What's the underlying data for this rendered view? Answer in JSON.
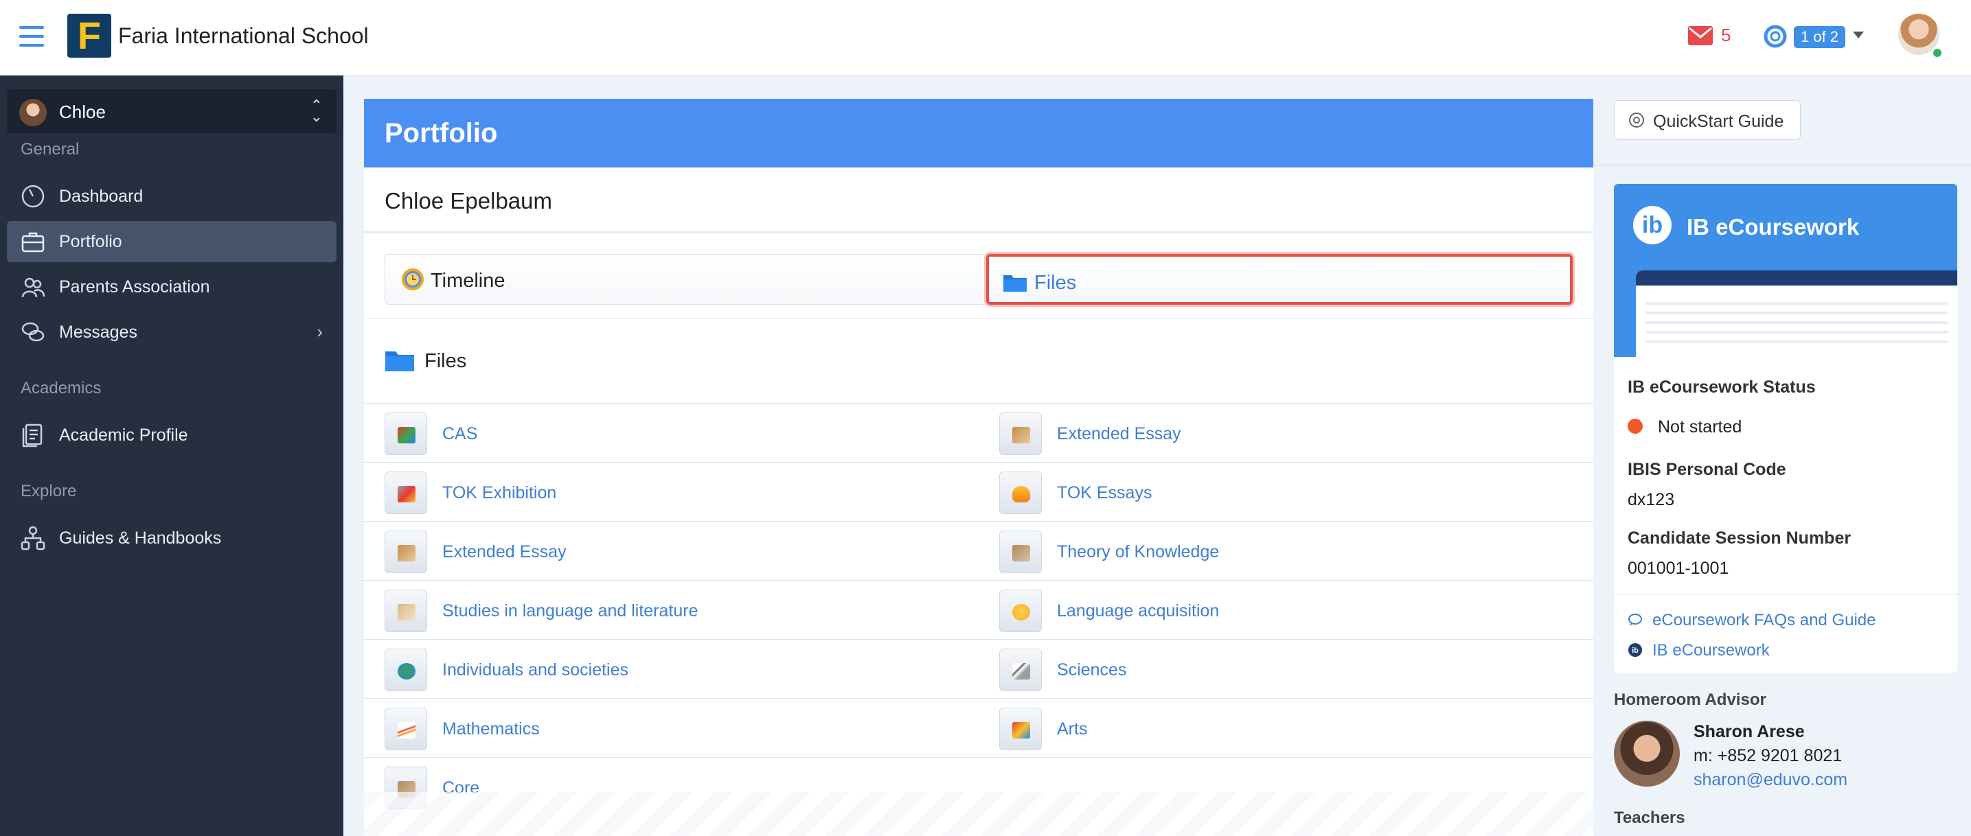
{
  "header": {
    "school_name": "Faria International School",
    "logo_letter": "F",
    "mail_count": "5",
    "pager": "1 of 2"
  },
  "sidebar": {
    "user_name": "Chloe",
    "section_general": "General",
    "section_academics": "Academics",
    "section_explore": "Explore",
    "items": [
      {
        "label": "Dashboard",
        "icon": "dashboard-icon"
      },
      {
        "label": "Portfolio",
        "icon": "briefcase-icon"
      },
      {
        "label": "Parents Association",
        "icon": "people-icon"
      },
      {
        "label": "Messages",
        "icon": "chat-icon"
      },
      {
        "label": "Academic Profile",
        "icon": "document-icon"
      },
      {
        "label": "Guides & Handbooks",
        "icon": "sitemap-icon"
      }
    ]
  },
  "main": {
    "title": "Portfolio",
    "student": "Chloe Epelbaum",
    "tabs": {
      "timeline": "Timeline",
      "files": "Files"
    },
    "files_heading": "Files",
    "folders_left": [
      "CAS",
      "TOK Exhibition",
      "Extended Essay",
      "Studies in language and literature",
      "Individuals and societies",
      "Mathematics",
      "Core"
    ],
    "folders_right": [
      "Extended Essay",
      "TOK Essays",
      "Theory of Knowledge",
      "Language acquisition",
      "Sciences",
      "Arts"
    ]
  },
  "right": {
    "quickstart": "QuickStart Guide",
    "ib_title": "IB eCoursework",
    "ib_logo": "ib",
    "status_label": "IB eCoursework Status",
    "status_value": "Not started",
    "ibis_label": "IBIS Personal Code",
    "ibis_value": "dx123",
    "csn_label": "Candidate Session Number",
    "csn_value": "001001-1001",
    "link_faq": "eCoursework FAQs and Guide",
    "link_ib": "IB eCoursework",
    "homeroom_label": "Homeroom Advisor",
    "advisor_name": "Sharon Arese",
    "advisor_phone": "m: +852 9201 8021",
    "advisor_email": "sharon@eduvo.com",
    "teachers_label": "Teachers"
  },
  "colors": {
    "accent": "#4c8ff2",
    "sidebar": "#262f3f",
    "link": "#3d7fd1",
    "alert": "#e5484d"
  }
}
